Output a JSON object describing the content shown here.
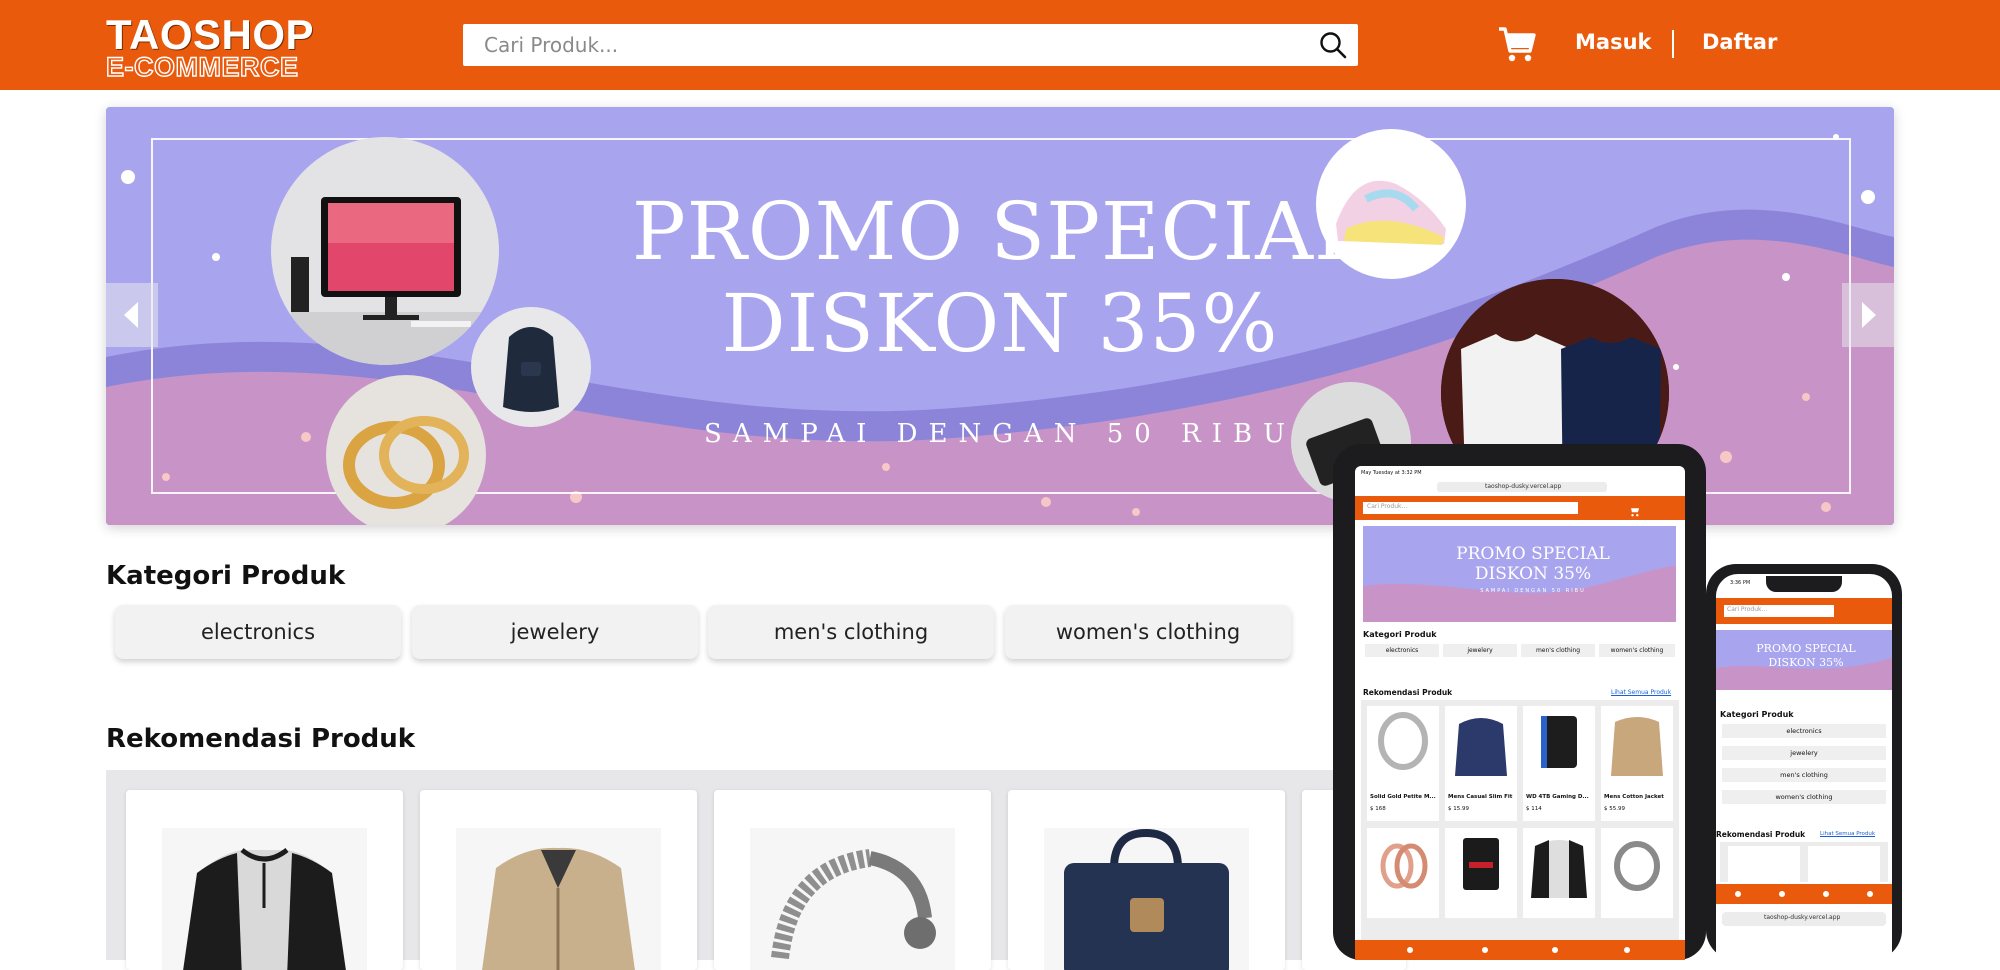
{
  "header": {
    "logo_line1": "TAOSHOP",
    "logo_line2": "E-COMMERCE",
    "search_placeholder": "Cari Produk...",
    "login": "Masuk",
    "register": "Daftar"
  },
  "banner": {
    "title_line1": "PROMO SPECIAL",
    "title_line2": "DISKON 35%",
    "subtitle": "SAMPAI DENGAN 50 RIBU"
  },
  "categories": {
    "title": "Kategori Produk",
    "items": [
      "electronics",
      "jewelery",
      "men's clothing",
      "women's clothing"
    ]
  },
  "recommendations": {
    "title": "Rekomendasi Produk"
  },
  "tablet": {
    "status_time": "May Tuesday at 3:32 PM",
    "url": "taoshop-dusky.vercel.app",
    "search_placeholder": "Cari Produk...",
    "banner_line1": "PROMO SPECIAL",
    "banner_line2": "DISKON 35%",
    "banner_sub": "SAMPAI DENGAN 50 RIBU",
    "categories_title": "Kategori Produk",
    "categories": [
      "electronics",
      "jewelery",
      "men's clothing",
      "women's clothing"
    ],
    "recommend_title": "Rekomendasi Produk",
    "see_all": "Lihat Semua Produk",
    "products": [
      {
        "name": "Solid Gold Petite M...",
        "price": "$ 168"
      },
      {
        "name": "Mens Casual Slim Fit",
        "price": "$ 15.99"
      },
      {
        "name": "WD 4TB Gaming D...",
        "price": "$ 114"
      },
      {
        "name": "Mens Cotton Jacket",
        "price": "$ 55.99"
      }
    ]
  },
  "phone": {
    "status_time": "3:36 PM",
    "url": "taoshop-dusky.vercel.app",
    "search_placeholder": "Cari Produk...",
    "banner_line1": "PROMO SPECIAL",
    "banner_line2": "DISKON 35%",
    "categories_title": "Kategori Produk",
    "categories": [
      "electronics",
      "jewelery",
      "men's clothing",
      "women's clothing"
    ],
    "recommend_title": "Rekomendasi Produk",
    "see_all": "Lihat Semua Produk"
  },
  "colors": {
    "brand": "#e95a0c",
    "banner_bg": "#a9a4ee",
    "banner_wave": "#c893c6",
    "link": "#1a5fd6"
  },
  "icons": [
    "search-icon",
    "cart-icon",
    "chevron-left-icon",
    "chevron-right-icon"
  ]
}
